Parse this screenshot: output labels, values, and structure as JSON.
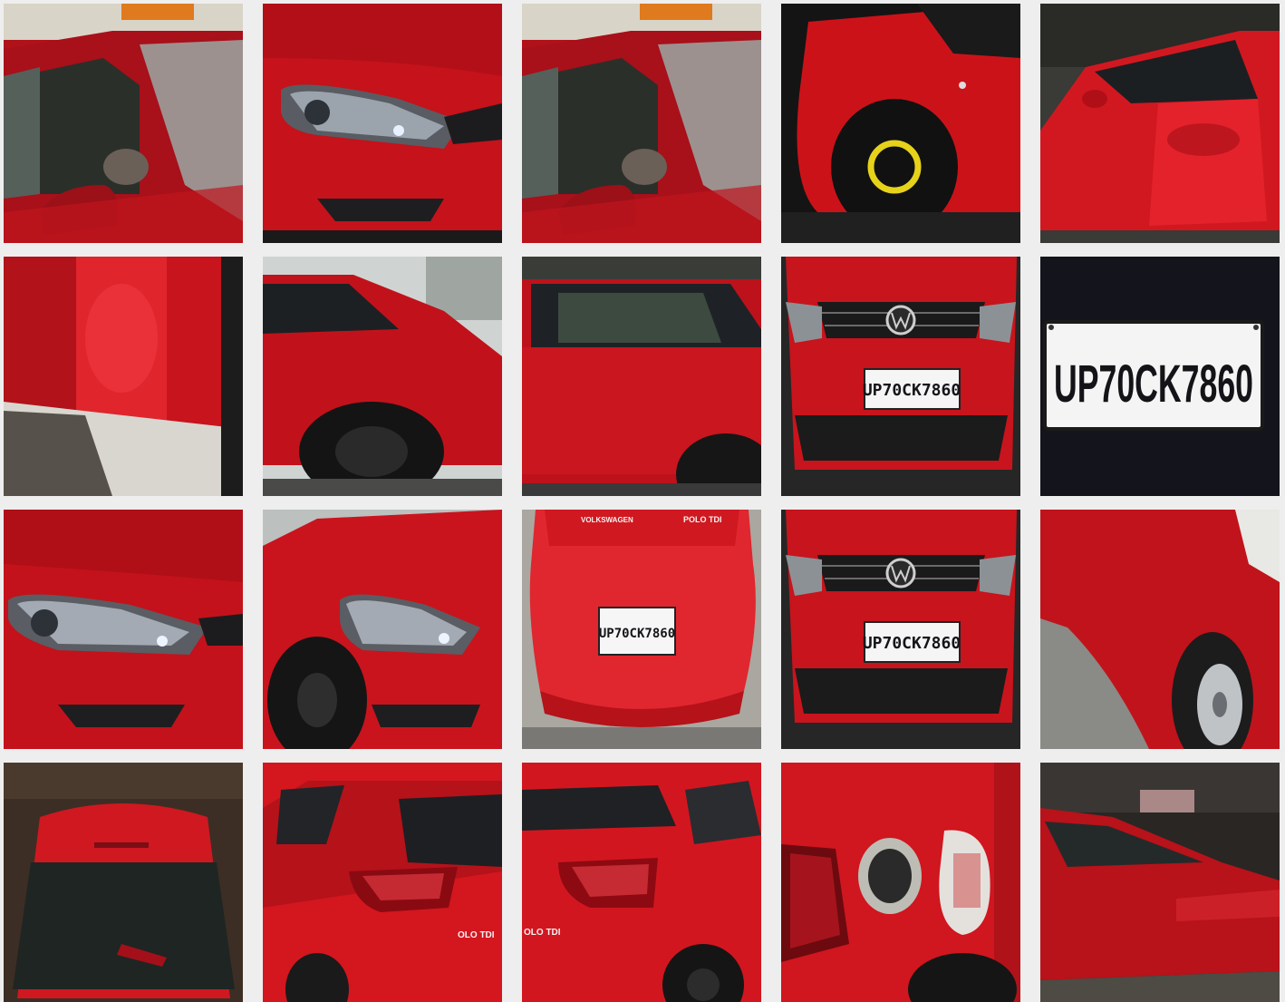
{
  "gallery": {
    "plate_number": "UP70CK7860",
    "rear_badge": "POLO TDI",
    "rear_brand_text": "VOLKSWAGEN",
    "side_badge": "OLO TDI",
    "tiles": [
      {
        "id": 1,
        "subject": "front-left-window-mirror"
      },
      {
        "id": 2,
        "subject": "headlight-closeup"
      },
      {
        "id": 3,
        "subject": "front-left-window-mirror"
      },
      {
        "id": 4,
        "subject": "front-wheel-spare"
      },
      {
        "id": 5,
        "subject": "driver-door"
      },
      {
        "id": 6,
        "subject": "door-panel-shadow"
      },
      {
        "id": 7,
        "subject": "rear-quarter-wheel"
      },
      {
        "id": 8,
        "subject": "side-rear-window"
      },
      {
        "id": 9,
        "subject": "front-grille-plate"
      },
      {
        "id": 10,
        "subject": "plate-closeup"
      },
      {
        "id": 11,
        "subject": "headlight-bumper"
      },
      {
        "id": 12,
        "subject": "front-corner-wheel"
      },
      {
        "id": 13,
        "subject": "rear-plate"
      },
      {
        "id": 14,
        "subject": "front-grille-plate"
      },
      {
        "id": 15,
        "subject": "front-fender-wheel"
      },
      {
        "id": 16,
        "subject": "roof-rear-windshield"
      },
      {
        "id": 17,
        "subject": "tail-light-left"
      },
      {
        "id": 18,
        "subject": "tail-light-right"
      },
      {
        "id": 19,
        "subject": "fuel-cap-open"
      },
      {
        "id": 20,
        "subject": "side-in-garage"
      }
    ]
  },
  "colors": {
    "background": "#eeeeee",
    "car_red": "#d4161f",
    "car_dark": "#8a0b12",
    "glass": "#2a2f33",
    "tyre": "#1a1a1a"
  }
}
